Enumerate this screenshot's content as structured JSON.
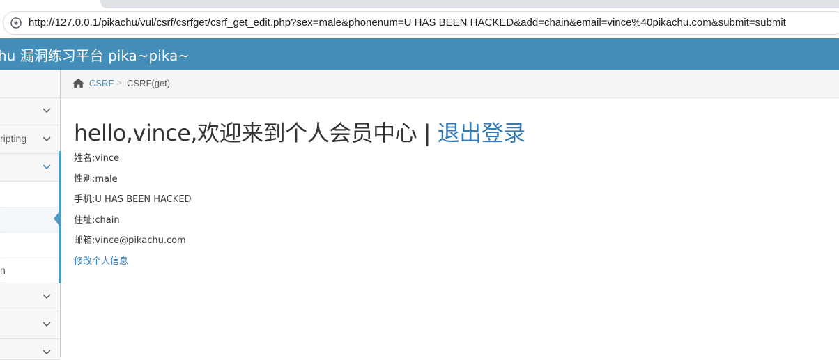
{
  "browser": {
    "url": "http://127.0.0.1/pikachu/vul/csrf/csrfget/csrf_get_edit.php?sex=male&phonenum=U HAS BEEN HACKED&add=chain&email=vince%40pikachu.com&submit=submit"
  },
  "navbar": {
    "brand": "hu 漏洞练习平台 pika~pika~",
    "bg_color": "#438eb9"
  },
  "sidebar": {
    "items": [
      {
        "label": "",
        "icon": "chevron-down-icon"
      },
      {
        "label": "ripting",
        "icon": "chevron-down-icon"
      },
      {
        "label": "",
        "icon": "chevron-down-icon",
        "expanded": true
      },
      {
        "label": "",
        "sub": true
      },
      {
        "label": "",
        "sub": true,
        "active": true
      },
      {
        "label": "",
        "sub": true
      },
      {
        "label": "n",
        "sub": true
      },
      {
        "label": "",
        "icon": "chevron-down-icon"
      },
      {
        "label": "",
        "icon": "chevron-down-icon"
      },
      {
        "label": "",
        "icon": "chevron-down-icon"
      }
    ]
  },
  "breadcrumb": {
    "home_icon": "home-icon",
    "link": "CSRF",
    "separator": ">",
    "current": "CSRF(get)"
  },
  "main": {
    "greeting": "hello,vince,欢迎来到个人会员中心 | ",
    "logout": "退出登录",
    "info": {
      "name": "姓名:vince",
      "sex": "性别:male",
      "phone": "手机:U HAS BEEN HACKED",
      "address": "住址:chain",
      "email": "邮箱:vince@pikachu.com"
    },
    "edit_link": "修改个人信息"
  }
}
